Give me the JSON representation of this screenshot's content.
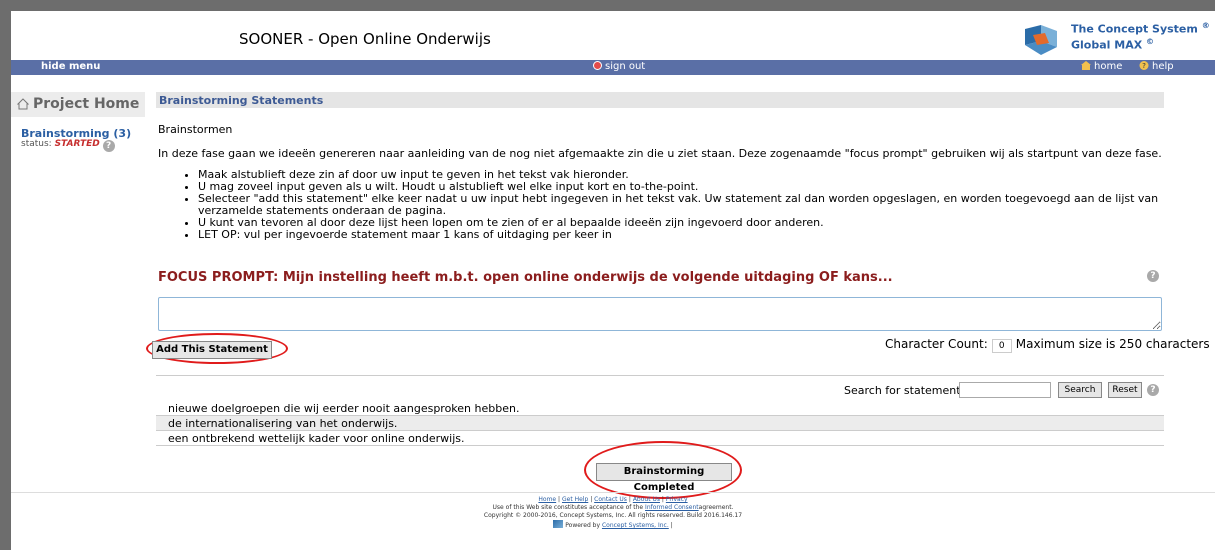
{
  "header": {
    "site_title": "SOONER - Open Online Onderwijs",
    "brand_line1": "The Concept System",
    "brand_line2": "Global MAX",
    "reg_mark": "®",
    "copy_mark": "©"
  },
  "nav": {
    "hide_menu": "hide menu",
    "sign_out": "sign out",
    "home": "home",
    "help": "help"
  },
  "sidebar": {
    "project_home": "Project Home",
    "activity_link": "Brainstorming (3)",
    "status_label": "status:",
    "status_value": "STARTED"
  },
  "main": {
    "section_title": "Brainstorming Statements",
    "sub_heading": "Brainstormen",
    "intro": "In deze fase gaan we ideeën genereren naar aanleiding van de nog niet afgemaakte zin die u ziet staan.  Deze zogenaamde \"focus prompt\" gebruiken wij als startpunt van deze fase.",
    "bullets": [
      "Maak alstublieft deze zin af door uw input te geven in het tekst vak hieronder.",
      "U mag zoveel input geven als u wilt. Houdt u alstublieft wel elke input kort en to-the-point.",
      "Selecteer \"add this statement\" elke keer nadat u uw input hebt ingegeven in het tekst vak. Uw statement zal dan worden opgeslagen, en worden toegevoegd aan de lijst van verzamelde statements onderaan de pagina.",
      "U kunt van tevoren al door deze lijst heen lopen om te zien of er al bepaalde ideeën zijn ingevoerd door anderen.",
      "LET OP: vul per ingevoerde statement maar 1 kans of uitdaging per keer in"
    ],
    "focus_prompt": "FOCUS PROMPT: Mijn instelling heeft m.b.t. open online onderwijs de volgende uitdaging OF kans...",
    "statement_value": "",
    "add_button": "Add This Statement",
    "char_count_label": "Character Count:",
    "char_count_value": "0",
    "max_size": "Maximum size is 250 characters",
    "search_label": "Search for statements:",
    "search_value": "",
    "search_button": "Search",
    "reset_button": "Reset",
    "statements": [
      "nieuwe doelgroepen die wij eerder nooit aangesproken hebben.",
      "de internationalisering van het onderwijs.",
      "een ontbrekend wettelijk kader voor online onderwijs."
    ],
    "completed_button": "Brainstorming Completed"
  },
  "footer": {
    "links": [
      "Home",
      "Get Help",
      "Contact Us",
      "About Us",
      "Privacy"
    ],
    "sep": "|",
    "line2_pre": "Use of this Web site constitutes acceptance of the",
    "line2_link": "Informed Consent",
    "line2_post": "agreement.",
    "copyright": "Copyright © 2000-2016, Concept Systems, Inc. All rights reserved. Build 2016.146.17",
    "powered_pre": "Powered by",
    "powered_link": "Concept Systems, Inc.",
    "powered_post": "|"
  },
  "colors": {
    "nav_bar": "#5a6fa6",
    "brand": "#2b5fa3",
    "focus_prompt": "#8b1d1d",
    "highlight_circle": "#e01b1b"
  }
}
